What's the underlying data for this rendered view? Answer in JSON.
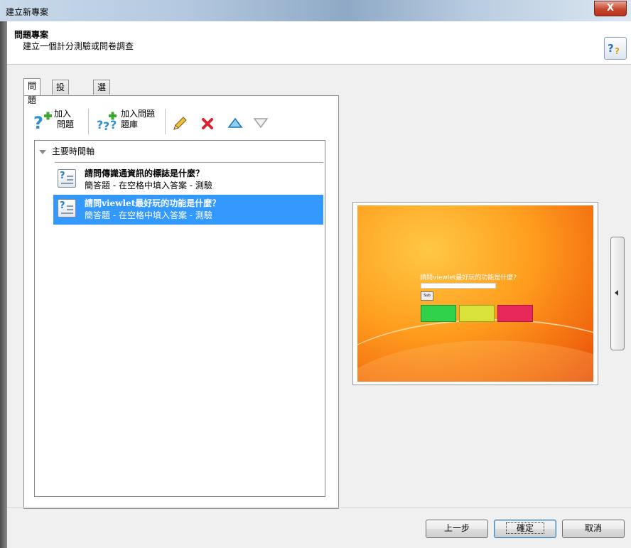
{
  "window": {
    "title": "建立新專案",
    "close_label": "X"
  },
  "header": {
    "title": "問題專案",
    "subtitle": "建立一個計分測驗或問卷調查",
    "help_icon": "help-icon"
  },
  "tabs": [
    {
      "label": "問題",
      "active": true
    },
    {
      "label": "投影片",
      "active": false
    },
    {
      "label": "選項",
      "active": false
    }
  ],
  "toolbar": {
    "add_question_line1": "加入",
    "add_question_line2": "問題",
    "add_pool_line1": "加入問題",
    "add_pool_line2": "題庫"
  },
  "tree": {
    "root_label": "主要時間軸",
    "items": [
      {
        "title": "請問傳識通資訊的標誌是什麼？",
        "subtitle": "簡答題 - 在空格中填入答案 - 測驗",
        "selected": false
      },
      {
        "title": "請問viewlet最好玩的功能是什麼？",
        "subtitle": "簡答題 - 在空格中填入答案 - 測驗",
        "selected": true
      }
    ]
  },
  "preview": {
    "question": "請問viewlet最好玩的功能是什麼?",
    "submit": "Sub"
  },
  "buttons": {
    "back": "上一步",
    "ok": "確定",
    "cancel": "取消"
  },
  "colors": {
    "selection": "#3399ff",
    "accent_red": "#d9232e"
  }
}
